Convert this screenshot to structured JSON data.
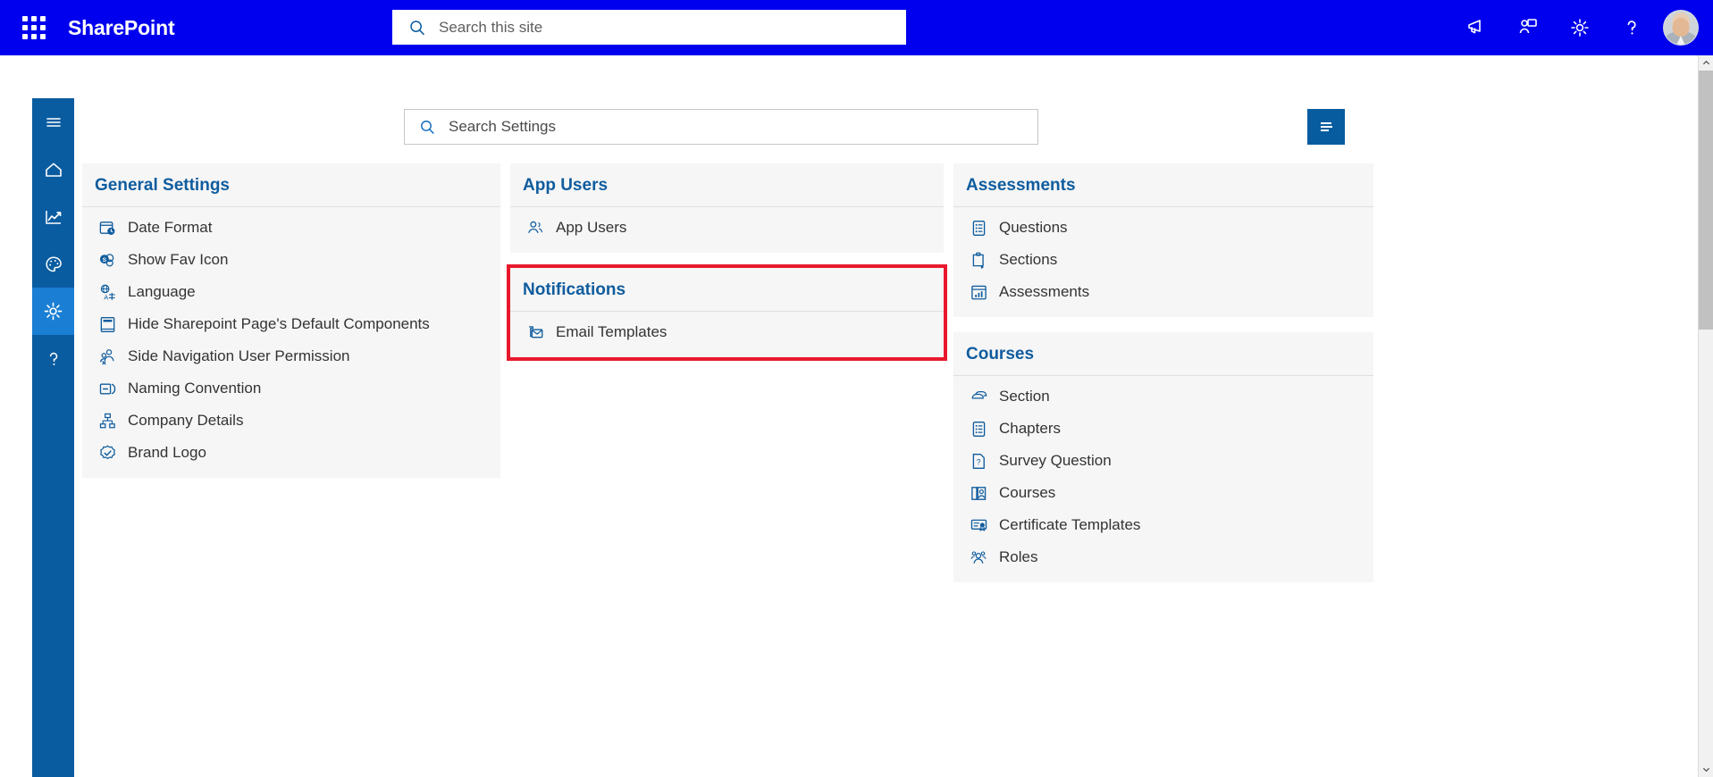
{
  "suite": {
    "brand": "SharePoint",
    "waffle_icon": "app-launcher-icon",
    "search": {
      "placeholder": "Search this site",
      "value": "",
      "icon": "search-icon"
    },
    "actions": [
      {
        "name": "announcements-icon",
        "label": "Announcements"
      },
      {
        "name": "chat-icon",
        "label": "Chat"
      },
      {
        "name": "settings-gear-icon",
        "label": "Settings"
      },
      {
        "name": "help-icon",
        "label": "Help"
      }
    ],
    "avatar": {
      "name": "user-avatar",
      "label": "Account manager"
    }
  },
  "rail": {
    "items": [
      {
        "icon": "hamburger-menu-icon",
        "label": "Menu",
        "active": false
      },
      {
        "icon": "home-icon",
        "label": "Home",
        "active": false
      },
      {
        "icon": "analytics-chart-icon",
        "label": "Analytics",
        "active": false
      },
      {
        "icon": "palette-icon",
        "label": "Theme",
        "active": false
      },
      {
        "icon": "gear-icon",
        "label": "Settings",
        "active": true
      },
      {
        "icon": "help-question-icon",
        "label": "Help",
        "active": false
      }
    ]
  },
  "toolbar": {
    "search": {
      "placeholder": "Search Settings",
      "value": "",
      "icon": "search-icon"
    },
    "filter_button": {
      "icon": "filter-lines-icon",
      "label": "Filter"
    }
  },
  "columns": [
    {
      "cards": [
        {
          "id": "general-settings",
          "title": "General Settings",
          "highlighted": false,
          "items": [
            {
              "label": "Date Format",
              "icon": "calendar-clock-icon"
            },
            {
              "label": "Show Fav Icon",
              "icon": "sharepoint-favicon-icon"
            },
            {
              "label": "Language",
              "icon": "language-translate-icon"
            },
            {
              "label": "Hide Sharepoint Page's Default Components",
              "icon": "page-layout-icon"
            },
            {
              "label": "Side Navigation User Permission",
              "icon": "user-permission-icon"
            },
            {
              "label": "Naming Convention",
              "icon": "naming-convention-icon"
            },
            {
              "label": "Company Details",
              "icon": "org-chart-icon"
            },
            {
              "label": "Brand Logo",
              "icon": "badge-check-icon"
            }
          ]
        }
      ]
    },
    {
      "cards": [
        {
          "id": "app-users",
          "title": "App Users",
          "highlighted": false,
          "items": [
            {
              "label": "App Users",
              "icon": "people-icon"
            }
          ]
        },
        {
          "id": "notifications",
          "title": "Notifications",
          "highlighted": true,
          "items": [
            {
              "label": "Email Templates",
              "icon": "email-template-icon"
            }
          ]
        }
      ]
    },
    {
      "cards": [
        {
          "id": "assessments",
          "title": "Assessments",
          "highlighted": false,
          "items": [
            {
              "label": "Questions",
              "icon": "question-list-icon"
            },
            {
              "label": "Sections",
              "icon": "clipboard-arrow-icon"
            },
            {
              "label": "Assessments",
              "icon": "assessment-board-icon"
            }
          ]
        },
        {
          "id": "courses",
          "title": "Courses",
          "highlighted": false,
          "items": [
            {
              "label": "Section",
              "icon": "layers-icon"
            },
            {
              "label": "Chapters",
              "icon": "chapter-list-icon"
            },
            {
              "label": "Survey Question",
              "icon": "survey-question-icon"
            },
            {
              "label": "Courses",
              "icon": "book-user-icon"
            },
            {
              "label": "Certificate Templates",
              "icon": "certificate-icon"
            },
            {
              "label": "Roles",
              "icon": "roles-people-icon"
            }
          ]
        }
      ]
    }
  ],
  "colors": {
    "suite_bar": "#0000ee",
    "rail": "#0a5ca0",
    "rail_active": "#1a7fd4",
    "card_bg": "#f6f6f6",
    "heading": "#0f5c9e",
    "highlight_outline": "#e8192c",
    "icon_blue": "#0f5c9e"
  },
  "scrollbar": {
    "up_icon": "chevron-up-icon",
    "down_icon": "chevron-down-icon"
  }
}
